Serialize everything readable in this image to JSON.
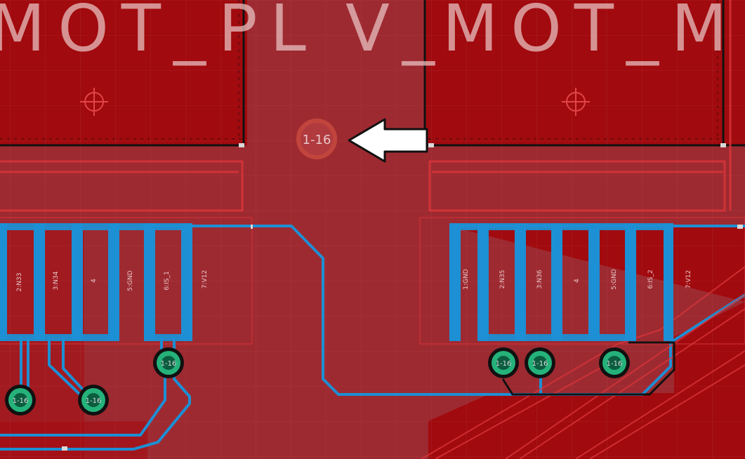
{
  "board": {
    "colors": {
      "background": "#9e2a31",
      "copper_top_pour": "#a10a0e",
      "bottom_trace": "#1d8fd4",
      "via_ring": "#25b27a",
      "silkscreen": "#e8c0c0",
      "outline_red": "#d8353a",
      "grid": "#b4525a"
    },
    "silkscreen": {
      "left_label": "MOT_PL",
      "middle_label": "V_",
      "right_label": "MOT_M"
    },
    "marker_via": {
      "label": "1-16",
      "pointer": "white-arrow-pointing-left"
    },
    "connector_left": {
      "pins": [
        "2:N33",
        "3:N34",
        "4",
        "5:GND",
        "6:IS_1",
        "7:V12"
      ]
    },
    "connector_right": {
      "pins": [
        "1:GND",
        "2:N35",
        "3:N36",
        "4",
        "5:GND",
        "6:IS_2",
        "7:V12"
      ]
    },
    "vias": {
      "label": "1-16"
    }
  }
}
